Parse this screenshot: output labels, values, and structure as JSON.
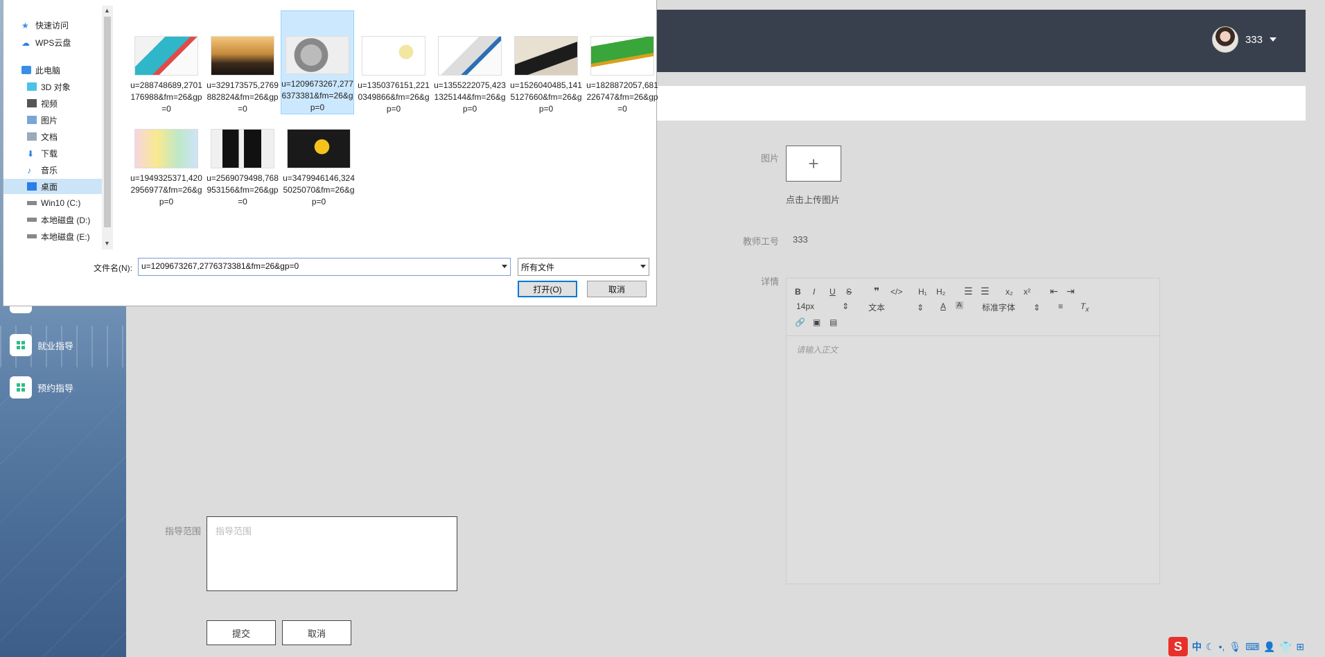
{
  "sidebar": {
    "items": [
      {
        "label": "就业指导"
      },
      {
        "label": "预约指导"
      }
    ]
  },
  "header": {
    "username": "333"
  },
  "form": {
    "image_label": "图片",
    "upload_icon": "plus-icon",
    "upload_tip": "点击上传图片",
    "teacher_id_label": "教师工号",
    "teacher_id_value": "333",
    "details_label": "详情",
    "editor": {
      "font_size": "14px",
      "text_style": "文本",
      "font_family": "标准字体",
      "placeholder": "请输入正文"
    },
    "scope_label": "指导范围",
    "scope_placeholder": "指导范围",
    "submit_label": "提交",
    "cancel_label": "取消"
  },
  "dialog": {
    "nav": [
      {
        "label": "快速访问",
        "icon": "star-icon"
      },
      {
        "label": "WPS云盘",
        "icon": "cloud-icon"
      },
      {
        "label": "此电脑",
        "icon": "computer-icon"
      },
      {
        "label": "3D 对象",
        "icon": "cube-icon"
      },
      {
        "label": "视频",
        "icon": "video-icon"
      },
      {
        "label": "图片",
        "icon": "picture-icon"
      },
      {
        "label": "文档",
        "icon": "document-icon"
      },
      {
        "label": "下载",
        "icon": "download-icon"
      },
      {
        "label": "音乐",
        "icon": "music-icon"
      },
      {
        "label": "桌面",
        "icon": "desktop-icon"
      },
      {
        "label": "Win10 (C:)",
        "icon": "drive-icon"
      },
      {
        "label": "本地磁盘 (D:)",
        "icon": "drive-icon"
      },
      {
        "label": "本地磁盘 (E:)",
        "icon": "drive-icon"
      }
    ],
    "files": [
      {
        "name": "u=288748689,2701176988&fm=26&gp=0"
      },
      {
        "name": "u=329173575,2769882824&fm=26&gp=0"
      },
      {
        "name": "u=1209673267,2776373381&fm=26&gp=0"
      },
      {
        "name": "u=1350376151,2210349866&fm=26&gp=0"
      },
      {
        "name": "u=1355222075,4231325144&fm=26&gp=0"
      },
      {
        "name": "u=1526040485,1415127660&fm=26&gp=0"
      },
      {
        "name": "u=1828872057,681226747&fm=26&gp=0"
      },
      {
        "name": "u=1949325371,4202956977&fm=26&gp=0"
      },
      {
        "name": "u=2569079498,768953156&fm=26&gp=0"
      },
      {
        "name": "u=3479946146,3245025070&fm=26&gp=0"
      }
    ],
    "filename_label": "文件名(N):",
    "filename_value": "u=1209673267,2776373381&fm=26&gp=0",
    "filetype_value": "所有文件",
    "open_label": "打开(O)",
    "cancel_label": "取消"
  },
  "tray": {
    "ime_label": "中"
  }
}
